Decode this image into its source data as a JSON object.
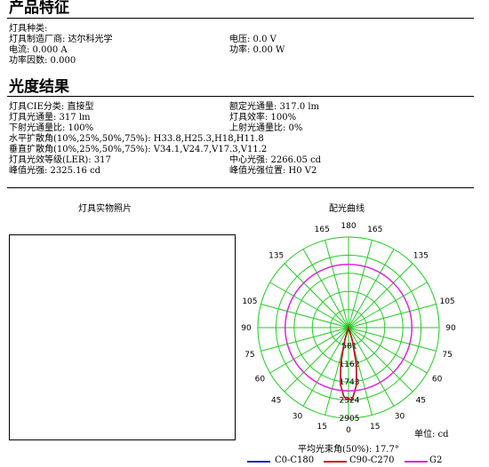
{
  "section1": {
    "title": "产品特征",
    "lamp_type": "灯具种类:",
    "manufacturer": "灯具制造厂商: 达尔科光学",
    "voltage": "电压: 0.0 V",
    "current": "电流: 0.000 A",
    "power": "功率: 0.00 W",
    "power_factor": "功率因数: 0.000"
  },
  "section2": {
    "title": "光度结果",
    "cie_class": "灯具CIE分类: 直接型",
    "rated_flux": "额定光通量: 317.0 lm",
    "lamp_flux": "灯具光通量: 317 lm",
    "efficiency": "灯具效率: 100%",
    "down_ratio": "下射光通量比: 100%",
    "up_ratio": "上射光通量比: 0%",
    "h_spread": "水平扩散角(10%,25%,50%,75%): H33.8,H25.3,H18,H11.8",
    "v_spread": "垂直扩散角(10%,25%,50%,75%): V34.1,V24.7,V17.3,V11.2",
    "ler": "灯具光效等级(LER): 317",
    "center_intensity": "中心光强: 2266.05 cd",
    "peak_intensity": "峰值光强: 2325.16 cd",
    "peak_position": "峰值光强位置: H0 V2"
  },
  "photo_caption": "灯具实物照片",
  "polar_caption": "配光曲线",
  "unit_label": "单位: cd",
  "beam_angle_label": "平均光束角(50%): 17.7°",
  "legend": [
    {
      "label": "C0-C180",
      "color": "#1a1acc"
    },
    {
      "label": "C90-C270",
      "color": "#d01010"
    },
    {
      "label": "G2",
      "color": "#e020e0"
    }
  ],
  "chart_data": {
    "type": "polar",
    "angle_labels": [
      "180",
      "165",
      "165",
      "135",
      "135",
      "105",
      "105",
      "90",
      "90",
      "75",
      "75",
      "60",
      "60",
      "45",
      "45",
      "30",
      "30",
      "15",
      "15",
      "0"
    ],
    "radial_ticks": [
      581,
      1162,
      1743,
      2324,
      2905
    ],
    "radial_max": 2905,
    "grid_color": "#22cc22",
    "series": [
      {
        "name": "C0-C180",
        "color": "#1a1acc",
        "points": [
          [
            -30,
            0
          ],
          [
            -20,
            0
          ],
          [
            -17,
            400
          ],
          [
            -12,
            1200
          ],
          [
            -8,
            1850
          ],
          [
            -4,
            2200
          ],
          [
            -2,
            2300
          ],
          [
            0,
            2266
          ],
          [
            2,
            2325
          ],
          [
            4,
            2200
          ],
          [
            8,
            1850
          ],
          [
            12,
            1200
          ],
          [
            17,
            400
          ],
          [
            20,
            0
          ],
          [
            30,
            0
          ]
        ]
      },
      {
        "name": "C90-C270",
        "color": "#d01010",
        "points": [
          [
            -30,
            0
          ],
          [
            -20,
            0
          ],
          [
            -17,
            400
          ],
          [
            -12,
            1200
          ],
          [
            -8,
            1850
          ],
          [
            -4,
            2200
          ],
          [
            -2,
            2300
          ],
          [
            0,
            2266
          ],
          [
            2,
            2325
          ],
          [
            4,
            2200
          ],
          [
            8,
            1850
          ],
          [
            12,
            1200
          ],
          [
            17,
            400
          ],
          [
            20,
            0
          ],
          [
            30,
            0
          ]
        ]
      },
      {
        "name": "G2",
        "color": "#e020e0",
        "radius_value": 2030
      }
    ]
  }
}
